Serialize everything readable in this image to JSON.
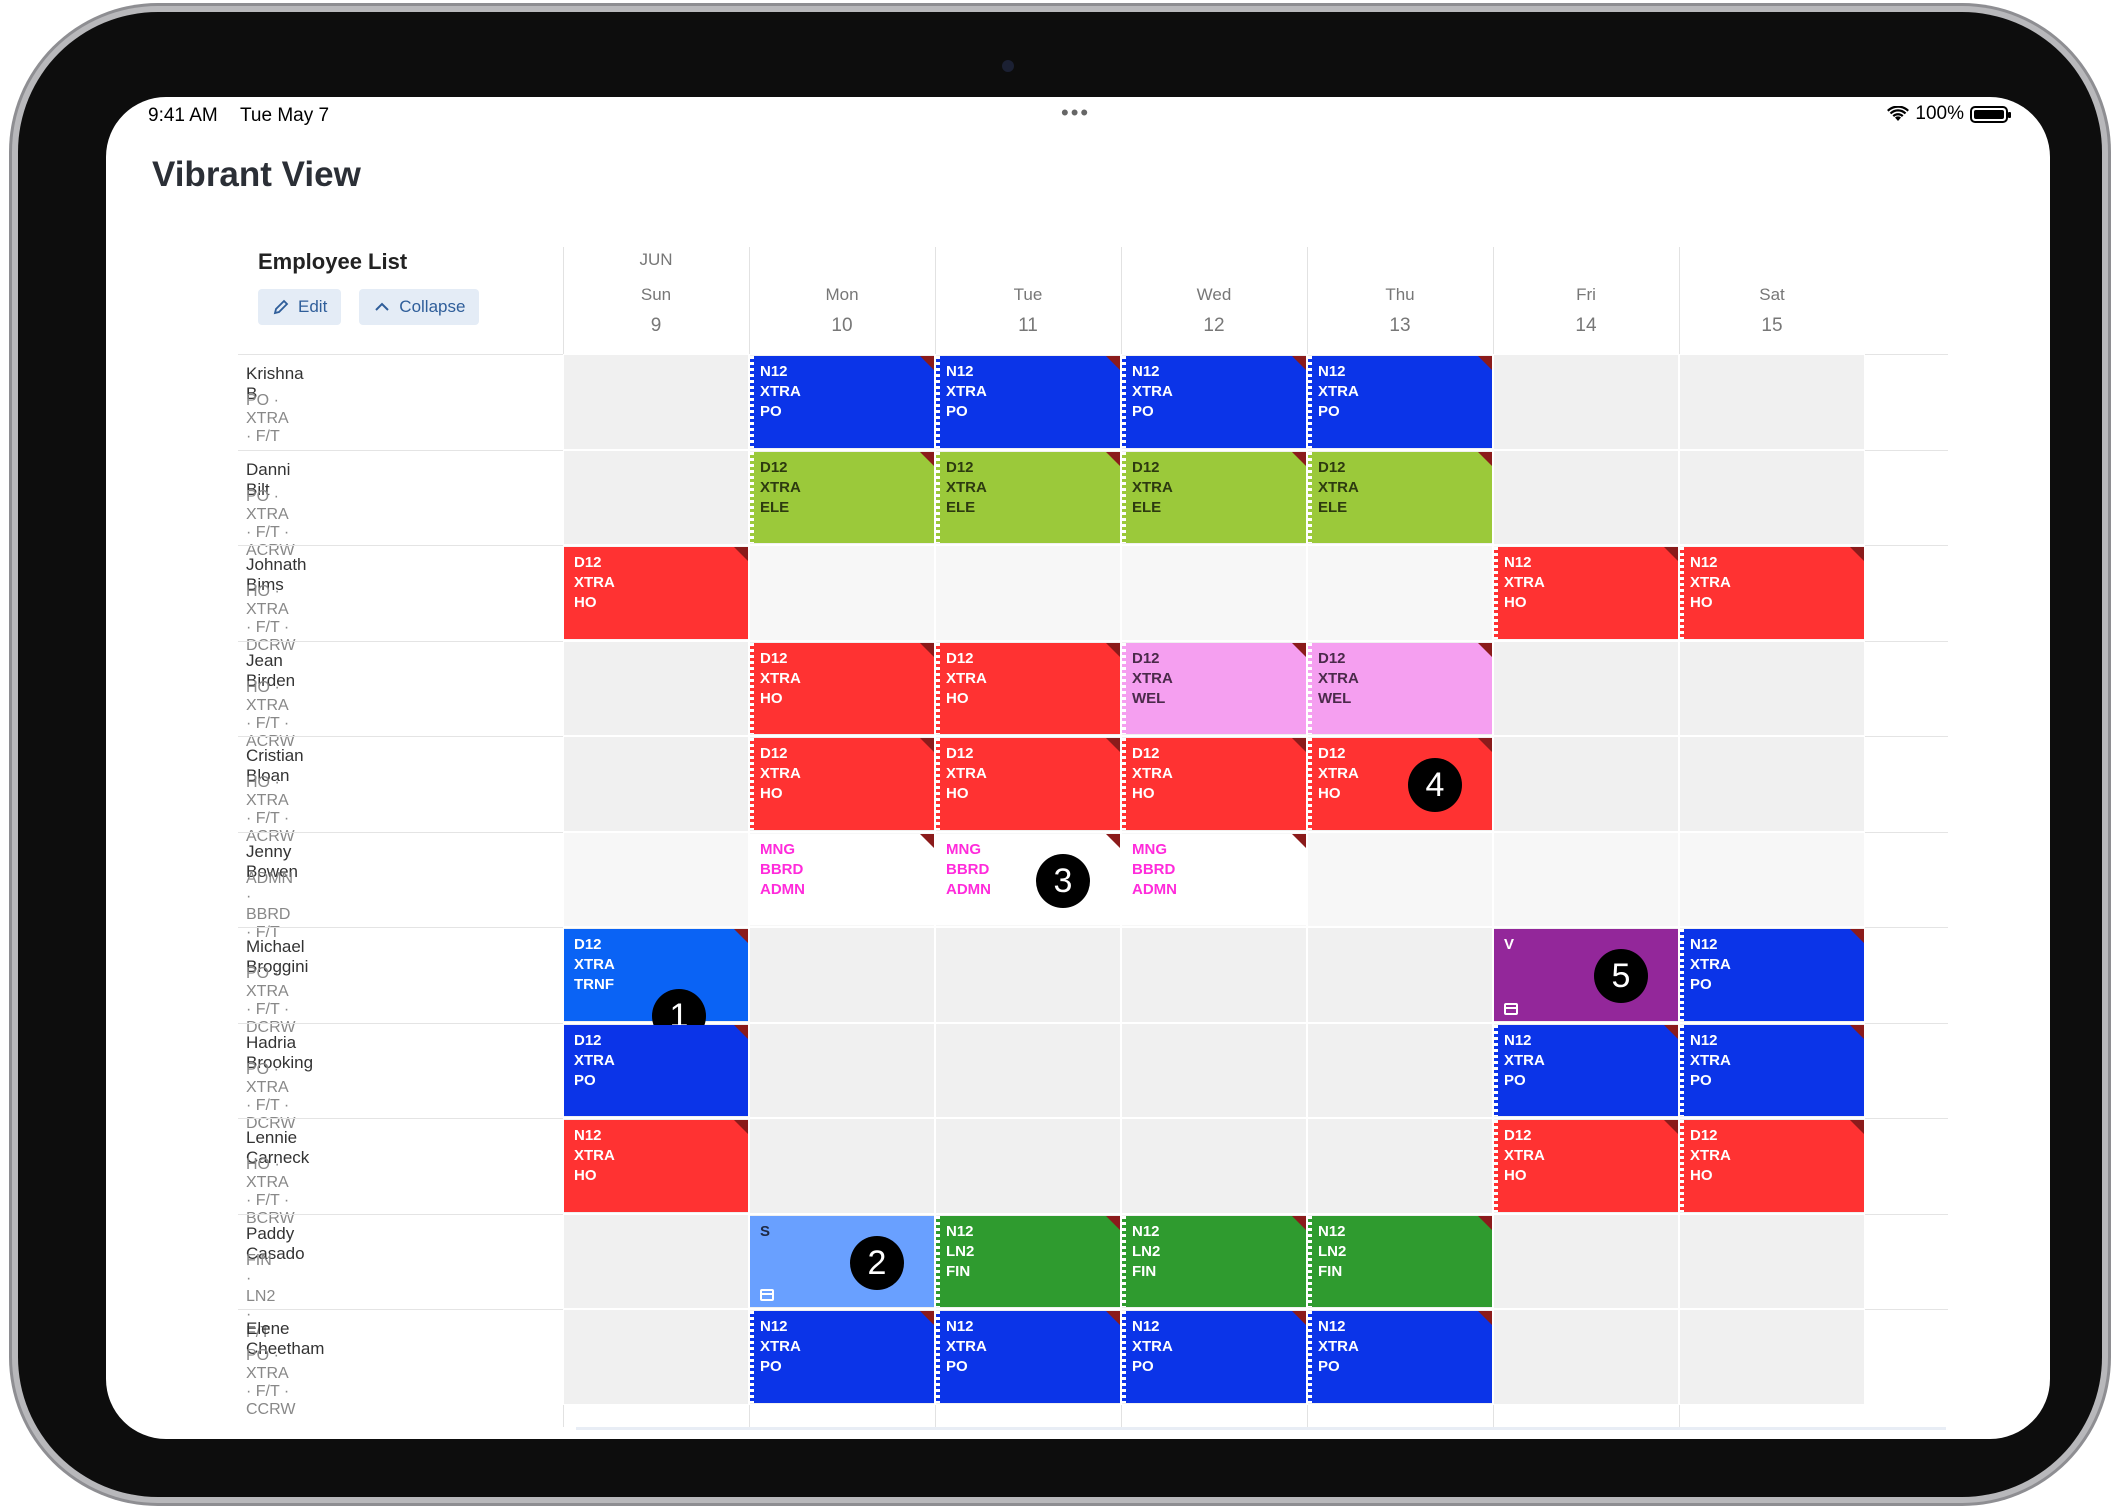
{
  "status": {
    "time": "9:41 AM",
    "date": "Tue May 7",
    "battery": "100%"
  },
  "app": {
    "title": "Vibrant View"
  },
  "employees_panel": {
    "title": "Employee List",
    "edit_label": "Edit",
    "collapse_label": "Collapse"
  },
  "month": "JUN",
  "days": [
    {
      "name": "Sun",
      "num": "9"
    },
    {
      "name": "Mon",
      "num": "10"
    },
    {
      "name": "Tue",
      "num": "11"
    },
    {
      "name": "Wed",
      "num": "12"
    },
    {
      "name": "Thu",
      "num": "13"
    },
    {
      "name": "Fri",
      "num": "14"
    },
    {
      "name": "Sat",
      "num": "15"
    }
  ],
  "employees": [
    {
      "name": "Krishna B",
      "meta": "PO · XTRA · F/T"
    },
    {
      "name": "Danni Bilt",
      "meta": "PO · XTRA · F/T · ACRW"
    },
    {
      "name": "Johnath Bims",
      "meta": "HO · XTRA · F/T · DCRW"
    },
    {
      "name": "Jean Birden",
      "meta": "HO · XTRA · F/T · ACRW"
    },
    {
      "name": "Cristian Bloan",
      "meta": "HO · XTRA · F/T · ACRW"
    },
    {
      "name": "Jenny Bowen",
      "meta": "ADMN · BBRD · F/T"
    },
    {
      "name": "Michael Broggini",
      "meta": "PO · XTRA · F/T · DCRW"
    },
    {
      "name": "Hadria Brooking",
      "meta": "PO · XTRA · F/T · DCRW"
    },
    {
      "name": "Lennie Carneck",
      "meta": "HO · XTRA · F/T · BCRW"
    },
    {
      "name": "Paddy Casado",
      "meta": "FIN · LN2 · F/T"
    },
    {
      "name": "Elene Cheetham",
      "meta": "PO · XTRA · F/T · CCRW"
    }
  ],
  "shifts": [
    {
      "row": 0,
      "day": 1,
      "color": "blue",
      "lines": [
        "N12",
        "XTRA",
        "PO"
      ]
    },
    {
      "row": 0,
      "day": 2,
      "color": "blue",
      "lines": [
        "N12",
        "XTRA",
        "PO"
      ]
    },
    {
      "row": 0,
      "day": 3,
      "color": "blue",
      "lines": [
        "N12",
        "XTRA",
        "PO"
      ]
    },
    {
      "row": 0,
      "day": 4,
      "color": "blue",
      "lines": [
        "N12",
        "XTRA",
        "PO"
      ]
    },
    {
      "row": 1,
      "day": 1,
      "color": "green",
      "lines": [
        "D12",
        "XTRA",
        "ELE"
      ]
    },
    {
      "row": 1,
      "day": 2,
      "color": "green",
      "lines": [
        "D12",
        "XTRA",
        "ELE"
      ]
    },
    {
      "row": 1,
      "day": 3,
      "color": "green",
      "lines": [
        "D12",
        "XTRA",
        "ELE"
      ]
    },
    {
      "row": 1,
      "day": 4,
      "color": "green",
      "lines": [
        "D12",
        "XTRA",
        "ELE"
      ]
    },
    {
      "row": 2,
      "day": 0,
      "color": "red",
      "lines": [
        "D12",
        "XTRA",
        "HO"
      ]
    },
    {
      "row": 2,
      "day": 5,
      "color": "red",
      "lines": [
        "N12",
        "XTRA",
        "HO"
      ]
    },
    {
      "row": 2,
      "day": 6,
      "color": "red",
      "lines": [
        "N12",
        "XTRA",
        "HO"
      ]
    },
    {
      "row": 3,
      "day": 1,
      "color": "red",
      "lines": [
        "D12",
        "XTRA",
        "HO"
      ]
    },
    {
      "row": 3,
      "day": 2,
      "color": "red",
      "lines": [
        "D12",
        "XTRA",
        "HO"
      ]
    },
    {
      "row": 3,
      "day": 3,
      "color": "pink",
      "lines": [
        "D12",
        "XTRA",
        "WEL"
      ]
    },
    {
      "row": 3,
      "day": 4,
      "color": "pink",
      "lines": [
        "D12",
        "XTRA",
        "WEL"
      ]
    },
    {
      "row": 4,
      "day": 1,
      "color": "red",
      "lines": [
        "D12",
        "XTRA",
        "HO"
      ]
    },
    {
      "row": 4,
      "day": 2,
      "color": "red",
      "lines": [
        "D12",
        "XTRA",
        "HO"
      ]
    },
    {
      "row": 4,
      "day": 3,
      "color": "red",
      "lines": [
        "D12",
        "XTRA",
        "HO"
      ]
    },
    {
      "row": 4,
      "day": 4,
      "color": "red",
      "lines": [
        "D12",
        "XTRA",
        "HO"
      ],
      "badge": "4"
    },
    {
      "row": 5,
      "day": 1,
      "color": "white",
      "lines": [
        "MNG",
        "BBRD",
        "ADMN"
      ]
    },
    {
      "row": 5,
      "day": 2,
      "color": "white",
      "lines": [
        "MNG",
        "BBRD",
        "ADMN"
      ],
      "badge": "3"
    },
    {
      "row": 5,
      "day": 3,
      "color": "white",
      "lines": [
        "MNG",
        "BBRD",
        "ADMN"
      ]
    },
    {
      "row": 6,
      "day": 0,
      "color": "dblue",
      "lines": [
        "D12",
        "XTRA",
        "TRNF"
      ],
      "badge": "1"
    },
    {
      "row": 6,
      "day": 5,
      "color": "purple",
      "lines": [
        "V"
      ],
      "badge": "5",
      "cal": true
    },
    {
      "row": 6,
      "day": 6,
      "color": "blue",
      "lines": [
        "N12",
        "XTRA",
        "PO"
      ]
    },
    {
      "row": 7,
      "day": 0,
      "color": "blue",
      "lines": [
        "D12",
        "XTRA",
        "PO"
      ]
    },
    {
      "row": 7,
      "day": 5,
      "color": "blue",
      "lines": [
        "N12",
        "XTRA",
        "PO"
      ]
    },
    {
      "row": 7,
      "day": 6,
      "color": "blue",
      "lines": [
        "N12",
        "XTRA",
        "PO"
      ]
    },
    {
      "row": 8,
      "day": 0,
      "color": "red",
      "lines": [
        "N12",
        "XTRA",
        "HO"
      ]
    },
    {
      "row": 8,
      "day": 5,
      "color": "red",
      "lines": [
        "D12",
        "XTRA",
        "HO"
      ]
    },
    {
      "row": 8,
      "day": 6,
      "color": "red",
      "lines": [
        "D12",
        "XTRA",
        "HO"
      ]
    },
    {
      "row": 9,
      "day": 1,
      "color": "lblue",
      "lines": [
        "S"
      ],
      "badge": "2",
      "cal": true
    },
    {
      "row": 9,
      "day": 2,
      "color": "dgreen",
      "lines": [
        "N12",
        "LN2",
        "FIN"
      ]
    },
    {
      "row": 9,
      "day": 3,
      "color": "dgreen",
      "lines": [
        "N12",
        "LN2",
        "FIN"
      ]
    },
    {
      "row": 9,
      "day": 4,
      "color": "dgreen",
      "lines": [
        "N12",
        "LN2",
        "FIN"
      ]
    },
    {
      "row": 10,
      "day": 1,
      "color": "blue",
      "lines": [
        "N12",
        "XTRA",
        "PO"
      ]
    },
    {
      "row": 10,
      "day": 2,
      "color": "blue",
      "lines": [
        "N12",
        "XTRA",
        "PO"
      ]
    },
    {
      "row": 10,
      "day": 3,
      "color": "blue",
      "lines": [
        "N12",
        "XTRA",
        "PO"
      ]
    },
    {
      "row": 10,
      "day": 4,
      "color": "blue",
      "lines": [
        "N12",
        "XTRA",
        "PO"
      ]
    }
  ]
}
